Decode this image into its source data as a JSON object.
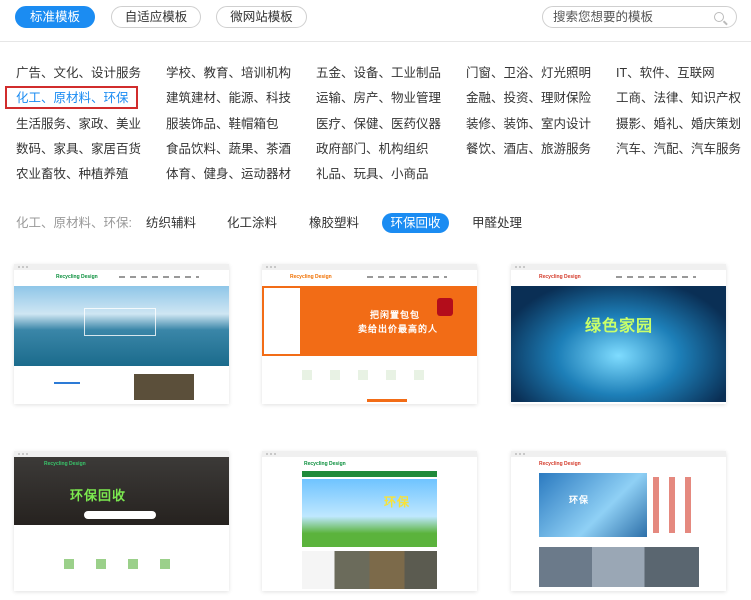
{
  "tabs": [
    {
      "label": "标准模板",
      "active": true
    },
    {
      "label": "自适应模板",
      "active": false
    },
    {
      "label": "微网站模板",
      "active": false
    }
  ],
  "search": {
    "placeholder": "搜索您想要的模板"
  },
  "categories": {
    "col1": [
      "广告、文化、设计服务",
      "化工、原材料、环保",
      "生活服务、家政、美业",
      "数码、家具、家居百货",
      "农业畜牧、种植养殖"
    ],
    "col2": [
      "学校、教育、培训机构",
      "建筑建材、能源、科技",
      "服装饰品、鞋帽箱包",
      "食品饮料、蔬果、茶酒",
      "体育、健身、运动器材"
    ],
    "col3": [
      "五金、设备、工业制品",
      "运输、房产、物业管理",
      "医疗、保健、医药仪器",
      "政府部门、机构组织",
      "礼品、玩具、小商品"
    ],
    "col4": [
      "门窗、卫浴、灯光照明",
      "金融、投资、理财保险",
      "装修、装饰、室内设计",
      "餐饮、酒店、旅游服务"
    ],
    "col5": [
      "IT、软件、互联网",
      "工商、法律、知识产权",
      "摄影、婚礼、婚庆策划",
      "汽车、汽配、汽车服务"
    ]
  },
  "selected_category": "化工、原材料、环保",
  "subfilter": {
    "crumb": "化工、原材料、环保:",
    "items": [
      {
        "label": "纺织辅料",
        "active": false
      },
      {
        "label": "化工涂料",
        "active": false
      },
      {
        "label": "橡胶塑料",
        "active": false
      },
      {
        "label": "环保回收",
        "active": true
      },
      {
        "label": "甲醛处理",
        "active": false
      }
    ]
  },
  "cards": [
    {
      "brand": "Recycling Design",
      "hero": "",
      "sub": ""
    },
    {
      "brand": "Recycling Design",
      "hero": "把闲置包包",
      "sub": "卖给出价最高的人"
    },
    {
      "brand": "Recycling Design",
      "hero": "绿色家园",
      "sub": ""
    },
    {
      "brand": "Recycling Design",
      "hero": "环保回收",
      "sub": ""
    },
    {
      "brand": "Recycling Design",
      "hero": "环保",
      "sub": ""
    },
    {
      "brand": "Recycling Design",
      "hero": "环保",
      "sub": ""
    }
  ],
  "colors": {
    "accent": "#1b8cf2",
    "highlight_border": "#d12c2c"
  }
}
